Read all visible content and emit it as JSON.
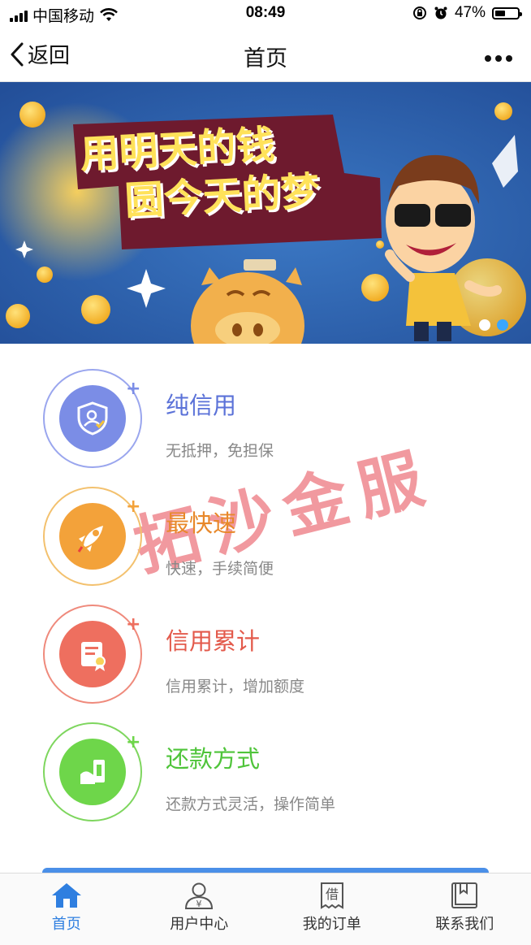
{
  "status_bar": {
    "carrier": "中国移动",
    "time": "08:49",
    "battery_percent": "47%"
  },
  "nav": {
    "back_label": "返回",
    "title": "首页"
  },
  "banner": {
    "slogan_line1": "用明天的钱",
    "slogan_line2": "圆今天的梦",
    "active_dot_index": 1
  },
  "features": [
    {
      "title": "纯信用",
      "desc": "无抵押，免担保",
      "color": "#7b8de6",
      "ring": "#9aa6ee",
      "title_color": "#5b72d8"
    },
    {
      "title": "最快速",
      "desc": "快速，手续简便",
      "color": "#f3a23a",
      "ring": "#f3c16e",
      "title_color": "#e8882a"
    },
    {
      "title": "信用累计",
      "desc": "信用累计，增加额度",
      "color": "#ee6f5f",
      "ring": "#ef8a7c",
      "title_color": "#e35a4b"
    },
    {
      "title": "还款方式",
      "desc": "还款方式灵活，操作简单",
      "color": "#6ed64a",
      "ring": "#7ed65e",
      "title_color": "#4fc43a"
    }
  ],
  "watermark": "拓沙金服",
  "tabbar": [
    {
      "label": "首页",
      "icon": "home-icon",
      "active": true
    },
    {
      "label": "用户中心",
      "icon": "user-center-icon",
      "active": false
    },
    {
      "label": "我的订单",
      "icon": "order-icon",
      "active": false
    },
    {
      "label": "联系我们",
      "icon": "contact-book-icon",
      "active": false
    }
  ],
  "colors": {
    "accent": "#2f7fe0",
    "banner_bg": "#2c5aa8"
  }
}
